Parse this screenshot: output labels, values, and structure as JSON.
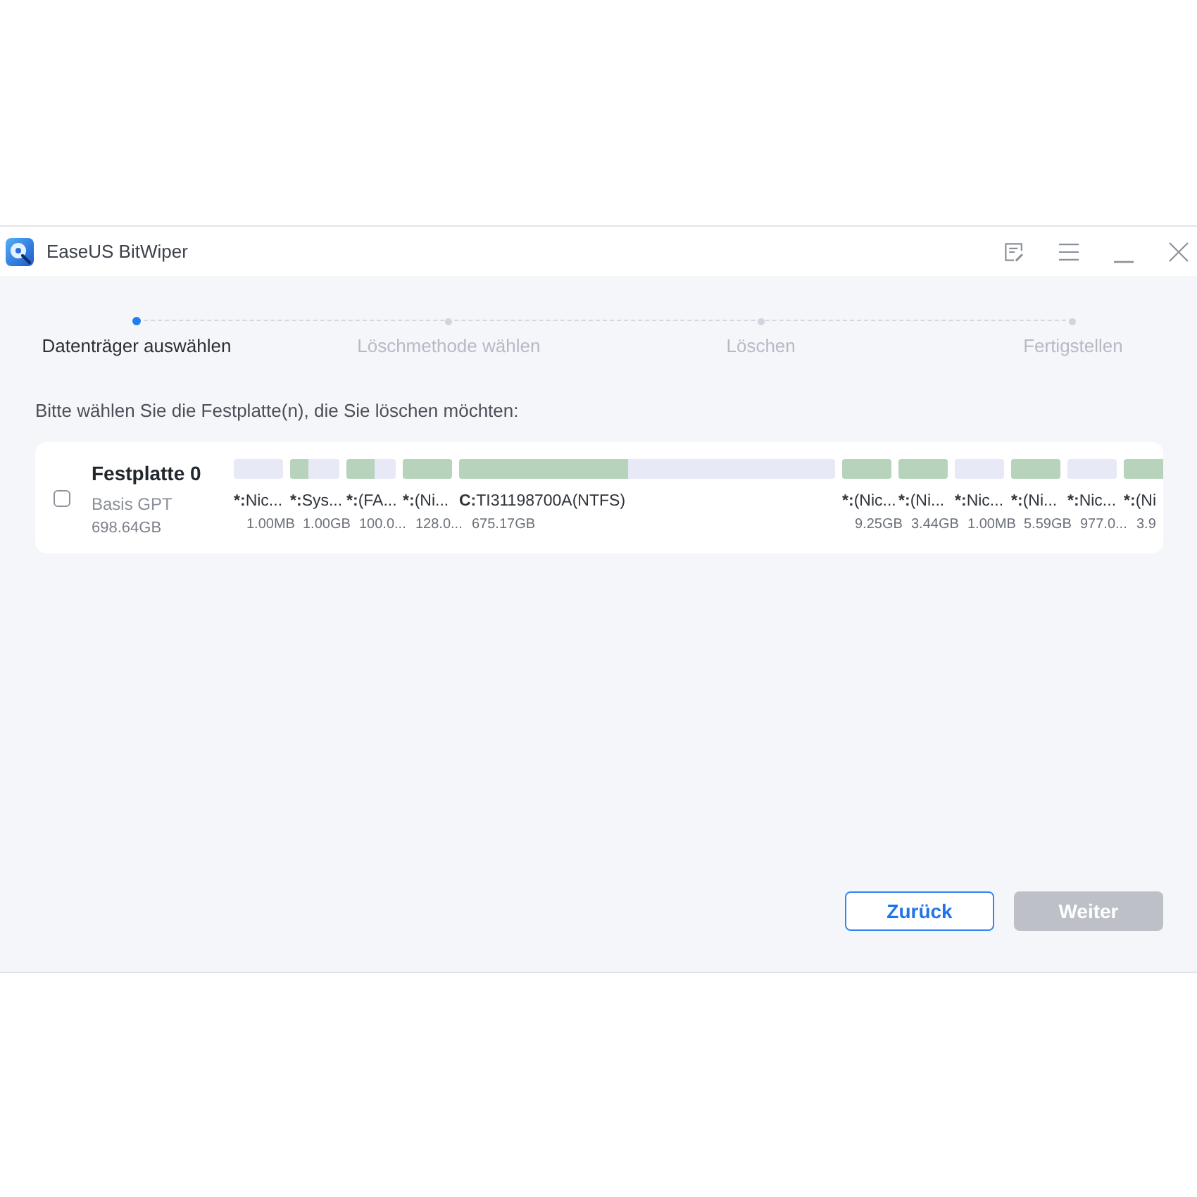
{
  "window": {
    "title": "EaseUS BitWiper"
  },
  "steps": [
    {
      "label": "Datenträger auswählen",
      "selected": true
    },
    {
      "label": "Löschmethode wählen",
      "selected": false
    },
    {
      "label": "Löschen",
      "selected": false
    },
    {
      "label": "Fertigstellen",
      "selected": false
    }
  ],
  "prompt": "Bitte wählen Sie die Festplatte(n), die Sie löschen möchten:",
  "disks": [
    {
      "name": "Festplatte 0",
      "type": "Basis GPT",
      "capacity": "698.64GB",
      "checked": false,
      "partitions": [
        {
          "kind": "small",
          "drive": "*:",
          "name": "Nic...",
          "size": "1.00MB",
          "level": 0
        },
        {
          "kind": "small",
          "drive": "*:",
          "name": "Sys...",
          "size": "1.00GB",
          "level": 0.37
        },
        {
          "kind": "small",
          "drive": "*:",
          "name": "(FA...",
          "size": "100.0...",
          "level": 0.57
        },
        {
          "kind": "small",
          "drive": "*:",
          "name": "(Ni...",
          "size": "128.0...",
          "level": 1
        },
        {
          "kind": "main",
          "drive": "C:",
          "name": "TI31198700A(NTFS)",
          "size": "675.17GB",
          "level": 0.45
        },
        {
          "kind": "small",
          "drive": "*:",
          "name": "(Nic...",
          "size": "9.25GB",
          "level": 1
        },
        {
          "kind": "small",
          "drive": "*:",
          "name": "(Ni...",
          "size": "3.44GB",
          "level": 1
        },
        {
          "kind": "small",
          "drive": "*:",
          "name": "Nic...",
          "size": "1.00MB",
          "level": 0
        },
        {
          "kind": "small",
          "drive": "*:",
          "name": "(Ni...",
          "size": "5.59GB",
          "level": 1
        },
        {
          "kind": "small",
          "drive": "*:",
          "name": "Nic...",
          "size": "977.0...",
          "level": 0
        },
        {
          "kind": "small",
          "drive": "*:",
          "name": "(Ni",
          "size": "3.9",
          "level": 1
        }
      ]
    }
  ],
  "buttons": [
    {
      "label": "Zurück",
      "kind": "secondary",
      "disabled": false
    },
    {
      "label": "Weiter",
      "kind": "primary",
      "disabled": true
    }
  ]
}
